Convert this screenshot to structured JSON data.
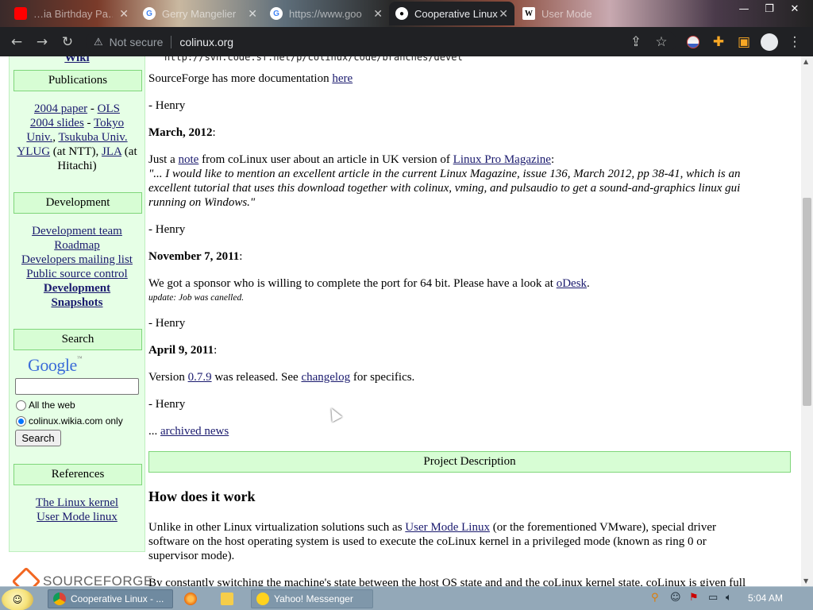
{
  "browser": {
    "tabs": [
      {
        "icon": "youtube-icon",
        "title": "…ia Birthday Pa…"
      },
      {
        "icon": "google-icon",
        "title": "Gerry Mangelier"
      },
      {
        "icon": "google-icon",
        "title": "https://www.goo"
      },
      {
        "icon": "github-icon",
        "title": "Cooperative Linux",
        "active": true
      },
      {
        "icon": "wikipedia-icon",
        "title": "User Mode"
      }
    ],
    "security_label": "Not secure",
    "url": "colinux.org"
  },
  "sidebar": {
    "wiki_link": "Wiki",
    "publications": {
      "heading": "Publications",
      "line1_a": "2004 paper",
      "line1_sep": " - ",
      "line1_b": "OLS",
      "line2_a": "2004 slides",
      "line2_sep": " - ",
      "line2_b": "Tokyo",
      "line3_a": "Univ.",
      "line3_sep": ", ",
      "line3_b": "Tsukuba Univ.",
      "line4_a": "YLUG",
      "line4_b": " (at NTT), ",
      "line4_c": "JLA",
      "line4_d": " (at",
      "line5": "Hitachi)"
    },
    "development": {
      "heading": "Development",
      "items": [
        "Development team",
        "Roadmap",
        "Developers mailing list",
        "Public source control",
        "Development",
        "Snapshots"
      ]
    },
    "search": {
      "heading": "Search",
      "logo": "Google",
      "logo_tm": "™",
      "option_web": "All the web",
      "option_site": "colinux.wikia.com only",
      "button": "Search"
    },
    "references": {
      "heading": "References",
      "items": [
        "The Linux kernel",
        "User Mode linux"
      ]
    },
    "sourceforge": "SOURCEFORGE"
  },
  "main": {
    "svn_line": "http://svn.code.sf.net/p/colinux/code/branches/devel",
    "sf_docs_pre": "SourceForge has more documentation ",
    "sf_docs_link": "here",
    "sign1": "- Henry",
    "date_mar": "March, 2012",
    "colon": ":",
    "mar_pre": "Just a ",
    "mar_link1": "note",
    "mar_mid": " from coLinux user about an article in UK version of ",
    "mar_link2": "Linux Pro Magazine",
    "mar_post": ":",
    "quote_l1": "\"... I would like to mention an excellent article in the current Linux Magazine, issue 136, March 2012, pp 38-41, which is an",
    "quote_l2": "excellent tutorial that uses this download together with colinux, vming, and pulsaudio to get a sound-and-graphics linux gui",
    "quote_l3": "running on Windows.\"",
    "sign2": "- Henry",
    "date_nov": "November 7, 2011",
    "nov_pre": "We got a sponsor who is willing to complete the port for 64 bit. Please have a look at ",
    "nov_link": "oDesk",
    "nov_post": ".",
    "nov_update": "update: Job was canelled.",
    "sign3": "- Henry",
    "date_apr": "April 9, 2011",
    "apr_pre": "Version ",
    "apr_link1": "0.7.9",
    "apr_mid": " was released. See ",
    "apr_link2": "changelog",
    "apr_post": " for specifics.",
    "sign4": "- Henry",
    "archived_pre": "... ",
    "archived_link": "archived news",
    "project_desc": "Project Description",
    "how_heading": "How does it work",
    "how_l1_pre": "Unlike in other Linux virtualization solutions such as ",
    "how_l1_link": "User Mode Linux",
    "how_l1_post": " (or the forementioned VMware), special driver",
    "how_l2": "software on the host operating system is used to execute the coLinux kernel in a privileged mode (known as ring 0 or",
    "how_l3": "supervisor mode).",
    "how_l4": "By constantly switching the machine's state between the host OS state and and the coLinux kernel state, coLinux is given full"
  },
  "taskbar": {
    "tasks": [
      {
        "icon": "chrome-icon",
        "label": "Cooperative Linux - ..."
      },
      {
        "icon": "firefox-icon",
        "label": ""
      },
      {
        "icon": "folder-icon",
        "label": ""
      },
      {
        "icon": "yahoo-messenger-icon",
        "label": "Yahoo! Messenger"
      }
    ],
    "clock": "5:04 AM"
  }
}
